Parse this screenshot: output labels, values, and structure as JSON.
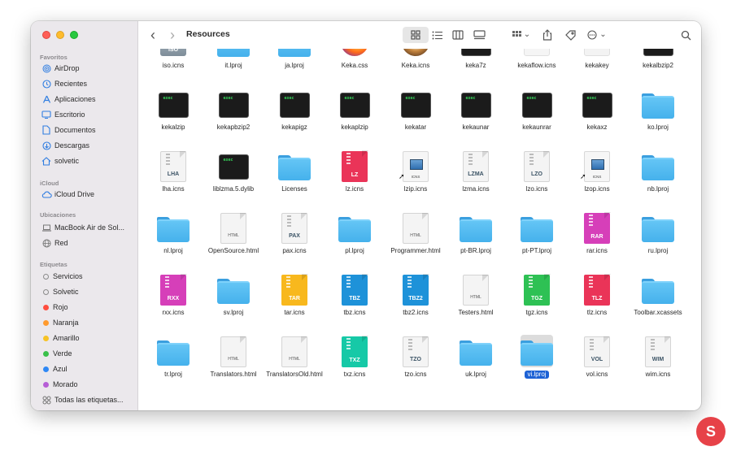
{
  "window": {
    "title": "Resources"
  },
  "sidebar": {
    "favorites_header": "Favoritos",
    "favorites": [
      {
        "label": "AirDrop",
        "icon": "airdrop-icon"
      },
      {
        "label": "Recientes",
        "icon": "clock-icon"
      },
      {
        "label": "Aplicaciones",
        "icon": "applications-icon"
      },
      {
        "label": "Escritorio",
        "icon": "desktop-icon"
      },
      {
        "label": "Documentos",
        "icon": "document-icon"
      },
      {
        "label": "Descargas",
        "icon": "downloads-icon"
      },
      {
        "label": "solvetic",
        "icon": "home-icon"
      }
    ],
    "icloud_header": "iCloud",
    "icloud": [
      {
        "label": "iCloud Drive",
        "icon": "cloud-icon"
      }
    ],
    "locations_header": "Ubicaciones",
    "locations": [
      {
        "label": "MacBook Air de Sol...",
        "icon": "laptop-icon"
      },
      {
        "label": "Red",
        "icon": "network-icon"
      }
    ],
    "tags_header": "Etiquetas",
    "tags": [
      {
        "label": "Servicios",
        "color": "hollow"
      },
      {
        "label": "Solvetic",
        "color": "hollow"
      },
      {
        "label": "Rojo",
        "color": "#ff4d3f"
      },
      {
        "label": "Naranja",
        "color": "#ff9a2e"
      },
      {
        "label": "Amarillo",
        "color": "#f7c325"
      },
      {
        "label": "Verde",
        "color": "#3ac04a"
      },
      {
        "label": "Azul",
        "color": "#2f88f5"
      },
      {
        "label": "Morado",
        "color": "#b65ed6"
      },
      {
        "label": "Todas las etiquetas...",
        "color": "all"
      }
    ]
  },
  "toolbar": {
    "back": "‹",
    "forward": "›",
    "view_icons": [
      "icon-view-icon",
      "list-view-icon",
      "column-view-icon",
      "gallery-view-icon"
    ],
    "group_caret": "⌄",
    "more_caret": "⌄"
  },
  "files": [
    [
      {
        "name": "iso.icns",
        "kind": "iso",
        "badge": "ISO"
      },
      {
        "name": "it.lproj",
        "kind": "folder"
      },
      {
        "name": "ja.lproj",
        "kind": "folder"
      },
      {
        "name": "Keka.css",
        "kind": "app-firefox"
      },
      {
        "name": "Keka.icns",
        "kind": "app-keka"
      },
      {
        "name": "keka7z",
        "kind": "exec"
      },
      {
        "name": "kekaflow.icns",
        "kind": "app-flow"
      },
      {
        "name": "kekakey",
        "kind": "blank"
      },
      {
        "name": "kekalbzip2",
        "kind": "exec"
      }
    ],
    [
      {
        "name": "kekalzip",
        "kind": "exec"
      },
      {
        "name": "kekapbzip2",
        "kind": "exec"
      },
      {
        "name": "kekapigz",
        "kind": "exec"
      },
      {
        "name": "kekaplzip",
        "kind": "exec"
      },
      {
        "name": "kekatar",
        "kind": "exec"
      },
      {
        "name": "kekaunar",
        "kind": "exec"
      },
      {
        "name": "kekaunrar",
        "kind": "exec"
      },
      {
        "name": "kekaxz",
        "kind": "exec"
      },
      {
        "name": "ko.lproj",
        "kind": "folder"
      }
    ],
    [
      {
        "name": "lha.icns",
        "kind": "zip",
        "badge": "LHA",
        "color": ""
      },
      {
        "name": "liblzma.5.dylib",
        "kind": "exec"
      },
      {
        "name": "Licenses",
        "kind": "folder"
      },
      {
        "name": "lz.icns",
        "kind": "zip",
        "badge": "LZ",
        "color": "#ea3458"
      },
      {
        "name": "lzip.icns",
        "kind": "icns-alias"
      },
      {
        "name": "lzma.icns",
        "kind": "zip",
        "badge": "LZMA",
        "color": ""
      },
      {
        "name": "lzo.icns",
        "kind": "zip",
        "badge": "LZO",
        "color": ""
      },
      {
        "name": "lzop.icns",
        "kind": "icns-alias"
      },
      {
        "name": "nb.lproj",
        "kind": "folder"
      }
    ],
    [
      {
        "name": "nl.lproj",
        "kind": "folder"
      },
      {
        "name": "OpenSource.html",
        "kind": "html",
        "badge": "HTML"
      },
      {
        "name": "pax.icns",
        "kind": "zip",
        "badge": "PAX",
        "color": ""
      },
      {
        "name": "pl.lproj",
        "kind": "folder"
      },
      {
        "name": "Programmer.html",
        "kind": "html",
        "badge": "HTML"
      },
      {
        "name": "pt-BR.lproj",
        "kind": "folder"
      },
      {
        "name": "pt-PT.lproj",
        "kind": "folder"
      },
      {
        "name": "rar.icns",
        "kind": "zip",
        "badge": "RAR",
        "color": "#d63fb9"
      },
      {
        "name": "ru.lproj",
        "kind": "folder"
      }
    ],
    [
      {
        "name": "rxx.icns",
        "kind": "zip",
        "badge": "RXX",
        "color": "#d63fb9"
      },
      {
        "name": "sv.lproj",
        "kind": "folder"
      },
      {
        "name": "tar.icns",
        "kind": "zip",
        "badge": "TAR",
        "color": "#f8b81d"
      },
      {
        "name": "tbz.icns",
        "kind": "zip",
        "badge": "TBZ",
        "color": "#1e92d9"
      },
      {
        "name": "tbz2.icns",
        "kind": "zip",
        "badge": "TBZ2",
        "color": "#1e92d9"
      },
      {
        "name": "Testers.html",
        "kind": "html",
        "badge": "HTML"
      },
      {
        "name": "tgz.icns",
        "kind": "zip",
        "badge": "TGZ",
        "color": "#2ec154"
      },
      {
        "name": "tlz.icns",
        "kind": "zip",
        "badge": "TLZ",
        "color": "#ea3458"
      },
      {
        "name": "Toolbar.xcassets",
        "kind": "folder"
      }
    ],
    [
      {
        "name": "tr.lproj",
        "kind": "folder"
      },
      {
        "name": "Translators.html",
        "kind": "html",
        "badge": "HTML"
      },
      {
        "name": "TranslatorsOld.html",
        "kind": "html",
        "badge": "HTML"
      },
      {
        "name": "txz.icns",
        "kind": "zip",
        "badge": "TXZ",
        "color": "#16c9a7"
      },
      {
        "name": "tzo.icns",
        "kind": "zip",
        "badge": "TZO",
        "color": ""
      },
      {
        "name": "uk.lproj",
        "kind": "folder"
      },
      {
        "name": "vi.lproj",
        "kind": "folder",
        "selected": true
      },
      {
        "name": "vol.icns",
        "kind": "zip",
        "badge": "VOL",
        "color": ""
      },
      {
        "name": "wim.icns",
        "kind": "zip",
        "badge": "WIM",
        "color": ""
      }
    ]
  ],
  "labels": {
    "exec": "exec",
    "icns": "ICNS",
    "alias_arrow": "➚"
  },
  "watermark": {
    "letter": "S"
  }
}
